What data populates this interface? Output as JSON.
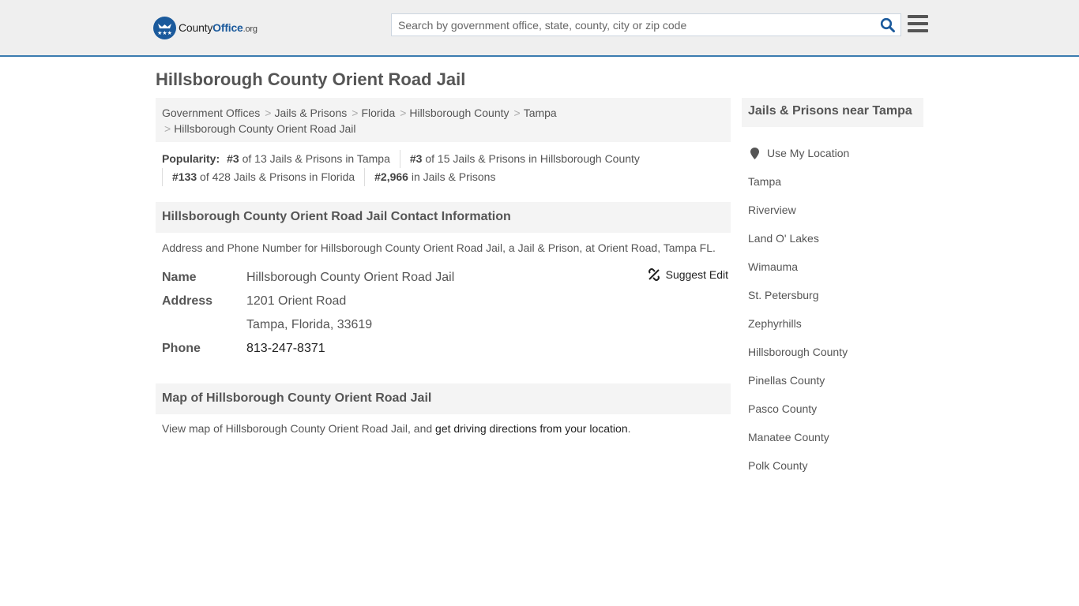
{
  "header": {
    "logo": {
      "county": "County",
      "office": "Office",
      "org": ".org"
    },
    "search": {
      "placeholder": "Search by government office, state, county, city or zip code",
      "value": ""
    },
    "icons": {
      "search": "search-icon",
      "menu": "hamburger-menu-icon"
    }
  },
  "page": {
    "title": "Hillsborough County Orient Road Jail"
  },
  "breadcrumb": [
    "Government Offices",
    "Jails & Prisons",
    "Florida",
    "Hillsborough County",
    "Tampa",
    "Hillsborough County Orient Road Jail"
  ],
  "popularity": {
    "label": "Popularity:",
    "items": [
      {
        "rank": "#3",
        "text": " of 13 Jails & Prisons in Tampa"
      },
      {
        "rank": "#3",
        "text": " of 15 Jails & Prisons in Hillsborough County"
      },
      {
        "rank": "#133",
        "text": " of 428 Jails & Prisons in Florida"
      },
      {
        "rank": "#2,966",
        "text": " in Jails & Prisons"
      }
    ]
  },
  "contact": {
    "heading": "Hillsborough County Orient Road Jail Contact Information",
    "description": "Address and Phone Number for Hillsborough County Orient Road Jail, a Jail & Prison, at Orient Road, Tampa FL.",
    "suggest_edit": "Suggest Edit",
    "name_label": "Name",
    "name_value": "Hillsborough County Orient Road Jail",
    "address_label": "Address",
    "address_line1": "1201 Orient Road",
    "address_line2": "Tampa, Florida, 33619",
    "phone_label": "Phone",
    "phone_value": "813-247-8371"
  },
  "map": {
    "heading": "Map of Hillsborough County Orient Road Jail",
    "text_prefix": "View map of Hillsborough County Orient Road Jail, and ",
    "link": "get driving directions from your location",
    "text_suffix": "."
  },
  "sidebar": {
    "heading": "Jails & Prisons near Tampa",
    "use_location": "Use My Location",
    "links": [
      "Tampa",
      "Riverview",
      "Land O' Lakes",
      "Wimauma",
      "St. Petersburg",
      "Zephyrhills",
      "Hillsborough County",
      "Pinellas County",
      "Pasco County",
      "Manatee County",
      "Polk County"
    ]
  },
  "colors": {
    "brand_blue": "#1b5a9c",
    "header_border": "#3b7bb0",
    "header_bg": "#efefef",
    "panel_bg": "#f4f4f4"
  }
}
